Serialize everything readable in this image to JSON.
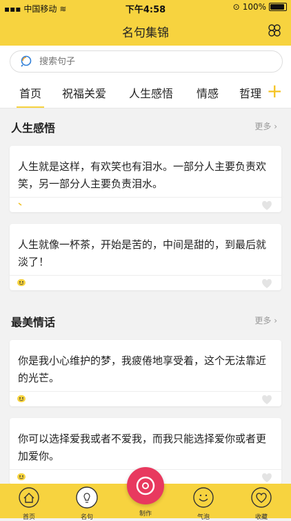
{
  "status": {
    "carrier": "中国移动",
    "time": "下午4:58",
    "battery": "100%"
  },
  "nav": {
    "title": "名句集锦"
  },
  "search": {
    "placeholder": "搜索句子"
  },
  "tabs": [
    {
      "label": "首页"
    },
    {
      "label": "祝福关爱"
    },
    {
      "label": "人生感悟"
    },
    {
      "label": "情感"
    },
    {
      "label": "哲理"
    }
  ],
  "sections": [
    {
      "title": "人生感悟",
      "more": "更多",
      "cards": [
        {
          "text": "人生就是这样，有欢笑也有泪水。一部分人主要负责欢笑，另一部分人主要负责泪水。"
        },
        {
          "text": "人生就像一杯茶，开始是苦的，中间是甜的，到最后就淡了！"
        }
      ]
    },
    {
      "title": "最美情话",
      "more": "更多",
      "cards": [
        {
          "text": "你是我小心维护的梦，我疲倦地享受着，这个无法靠近的光芒。"
        },
        {
          "text": "你可以选择爱我或者不爱我，而我只能选择爱你或者更加爱你。"
        }
      ]
    }
  ],
  "tabbar": [
    {
      "label": "首页",
      "icon": "home-icon"
    },
    {
      "label": "名句",
      "icon": "bulb-icon"
    },
    {
      "label": "制作",
      "icon": "camera-icon"
    },
    {
      "label": "气泡",
      "icon": "smile-icon"
    },
    {
      "label": "收藏",
      "icon": "heart-icon"
    }
  ],
  "colors": {
    "accent": "#f7d33f",
    "make_button": "#e8395f"
  }
}
